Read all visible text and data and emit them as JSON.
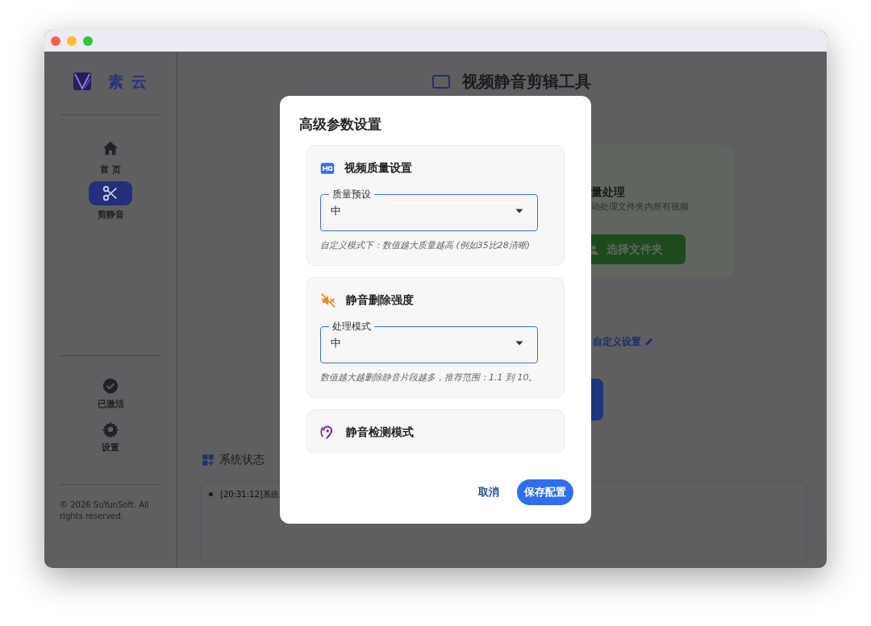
{
  "app": {
    "logo_text": "素 云"
  },
  "sidebar": {
    "items": [
      {
        "label": "首 页",
        "selected": false
      },
      {
        "label": "剪静音",
        "selected": true
      }
    ],
    "bottom_items": [
      {
        "label": "已激活"
      },
      {
        "label": "设置"
      }
    ],
    "copyright": "© 2026 SuYunSoft. All rights reserved."
  },
  "main": {
    "title": "视频静音剪辑工具",
    "batch_card": {
      "title": "量处理",
      "subtitle": "动处理文件夹内所有视频",
      "button": "选择文件夹"
    },
    "custom_link": "自定义设置",
    "status": {
      "title": "系统状态",
      "log": [
        "[20:31:12]系统"
      ]
    }
  },
  "dialog": {
    "title": "高级参数设置",
    "sections": [
      {
        "title": "视频质量设置",
        "field": {
          "label": "质量预设",
          "value": "中"
        },
        "hint": "自定义模式下：数值越大质量越高 (例如35比28清晰)"
      },
      {
        "title": "静音删除强度",
        "field": {
          "label": "处理模式",
          "value": "中"
        },
        "hint": "数值越大越删除静音片段越多，推荐范围：1.1 到 10。"
      },
      {
        "title": "静音检测模式"
      }
    ],
    "buttons": [
      {
        "label": "取消",
        "kind": "text"
      },
      {
        "label": "保存配置",
        "kind": "primary"
      }
    ]
  }
}
